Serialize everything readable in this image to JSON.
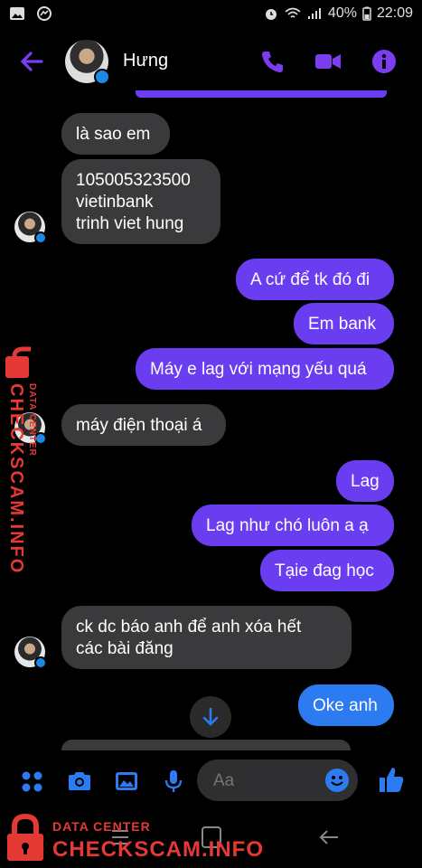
{
  "status": {
    "battery": "40%",
    "time": "22:09"
  },
  "header": {
    "contact_name": "Hưng"
  },
  "messages": [
    {
      "side": "in",
      "text": "là sao em"
    },
    {
      "side": "in",
      "text": "105005323500\nvietinbank\ntrinh viet hung"
    },
    {
      "side": "out",
      "text": "A cứ để tk đó đi"
    },
    {
      "side": "out",
      "text": "Em bank"
    },
    {
      "side": "out",
      "text": "Máy e lag với mạng yếu quá"
    },
    {
      "side": "in",
      "text": "máy điện thoại á"
    },
    {
      "side": "out",
      "text": "Lag"
    },
    {
      "side": "out",
      "text": "Lag như chó luôn a ạ"
    },
    {
      "side": "out",
      "text": "Tạie đag học"
    },
    {
      "side": "in",
      "text": "ck dc báo anh để anh xóa hết\ncác bài đăng"
    },
    {
      "side": "out",
      "text": "Oke anh"
    }
  ],
  "composer": {
    "placeholder": "Aa"
  },
  "watermark": {
    "top": "DATA CENTER",
    "main": "CHECKSCAM.INFO",
    "side_main": "CHECKSCAM.INFO",
    "side_small": "DATA CENTER"
  },
  "colors": {
    "accent": "#6a3df0",
    "blue": "#2d7bf0",
    "incoming": "#3a3a3c",
    "watermark": "#e53935"
  },
  "icons": [
    "back-arrow-icon",
    "phone-icon",
    "video-icon",
    "info-icon",
    "menu-dots-icon",
    "camera-icon",
    "gallery-icon",
    "microphone-icon",
    "emoji-icon",
    "thumbs-up-icon",
    "scroll-down-icon"
  ]
}
